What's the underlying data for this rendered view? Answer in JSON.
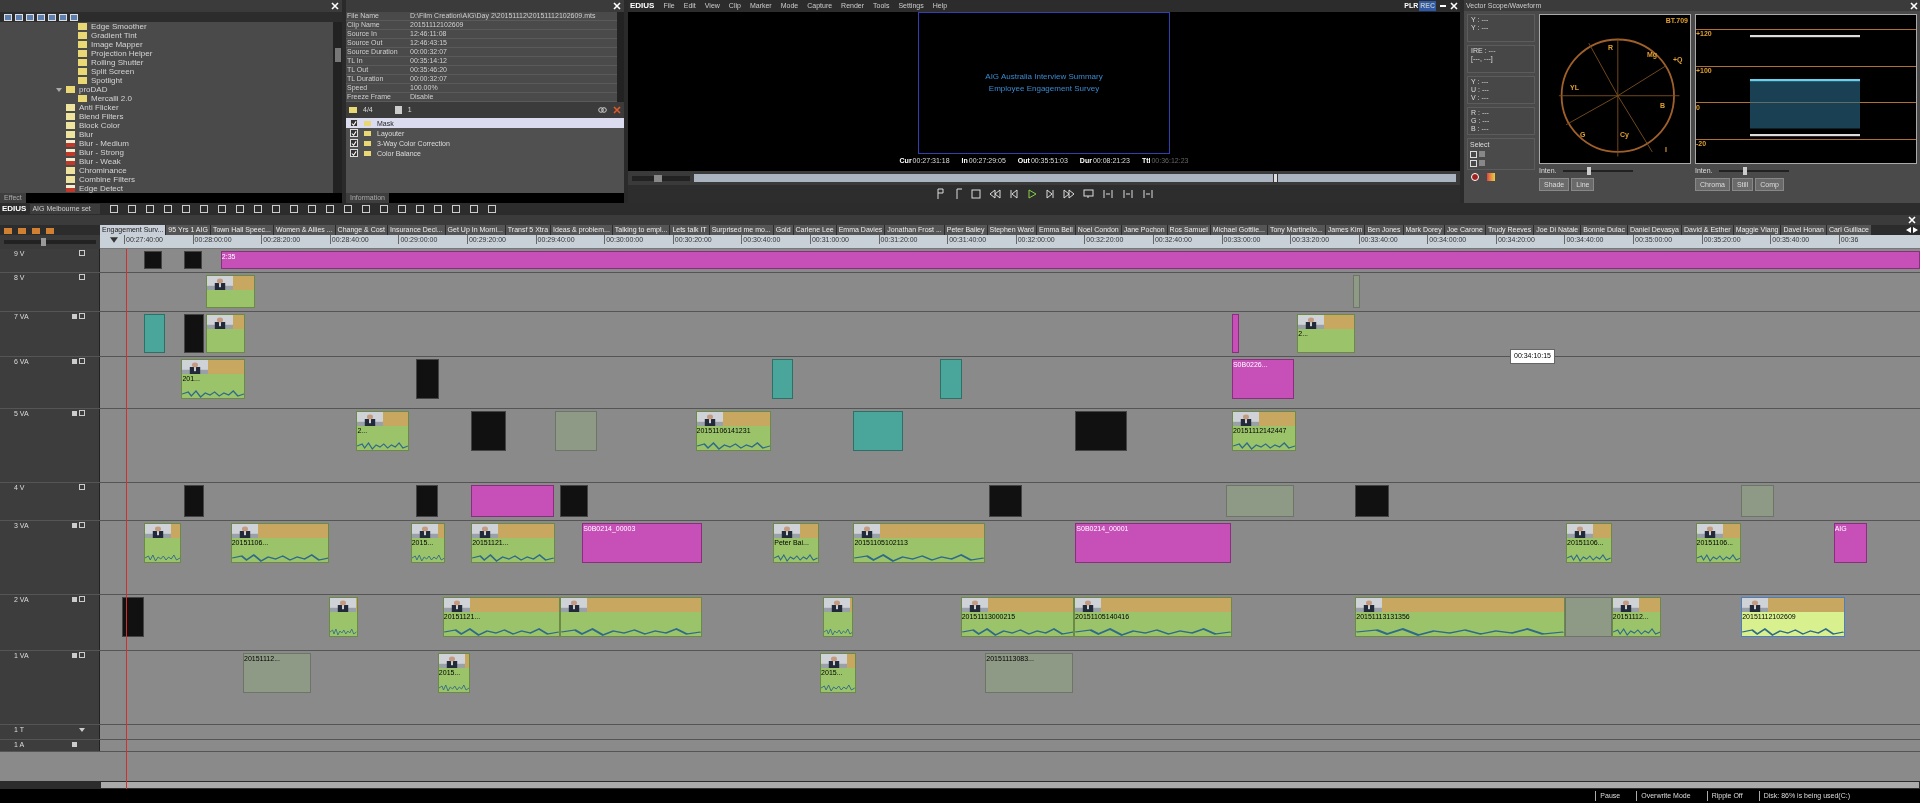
{
  "effect_panel": {
    "tab": "Effect",
    "tree": [
      {
        "kind": "effect",
        "label": "Edge Smoother"
      },
      {
        "kind": "effect",
        "label": "Gradient Tint"
      },
      {
        "kind": "effect",
        "label": "Image Mapper"
      },
      {
        "kind": "effect",
        "label": "Projection Helper"
      },
      {
        "kind": "effect",
        "label": "Rolling Shutter"
      },
      {
        "kind": "effect",
        "label": "Split Screen"
      },
      {
        "kind": "effect",
        "label": "Spotlight"
      },
      {
        "kind": "folder",
        "label": "proDAD",
        "expanded": true,
        "children": [
          {
            "kind": "effect",
            "label": "Mercalli 2.0"
          }
        ]
      },
      {
        "kind": "filter",
        "label": "Anti Flicker"
      },
      {
        "kind": "filter",
        "label": "Blend Filters"
      },
      {
        "kind": "filter",
        "label": "Block Color"
      },
      {
        "kind": "filter",
        "label": "Blur"
      },
      {
        "kind": "red",
        "label": "Blur - Medium"
      },
      {
        "kind": "red",
        "label": "Blur - Strong"
      },
      {
        "kind": "red",
        "label": "Blur - Weak"
      },
      {
        "kind": "filter",
        "label": "Chrominance"
      },
      {
        "kind": "filter",
        "label": "Combine Filters"
      },
      {
        "kind": "red",
        "label": "Edge Detect"
      }
    ]
  },
  "info_panel": {
    "tab": "Information",
    "rows": [
      {
        "label": "File Name",
        "value": "D:\\Film Creation\\AIG\\Day 2\\20151112\\20151112102609.mts"
      },
      {
        "label": "Clip Name",
        "value": "20151112102609"
      },
      {
        "label": "Source In",
        "value": "12:46:11:08"
      },
      {
        "label": "Source Out",
        "value": "12:46:43:15"
      },
      {
        "label": "Source Duration",
        "value": "00:00:32:07"
      },
      {
        "label": "TL In",
        "value": "00:35:14:12"
      },
      {
        "label": "TL Out",
        "value": "00:35:46:20"
      },
      {
        "label": "TL Duration",
        "value": "00:00:32:07"
      },
      {
        "label": "Speed",
        "value": "100.00%"
      },
      {
        "label": "Freeze Frame",
        "value": "Disable"
      }
    ],
    "filter_count": "4/4",
    "layer_count": "1",
    "filters": [
      {
        "label": "Mask",
        "checked": true,
        "selected": true
      },
      {
        "label": "Layouter",
        "checked": true,
        "selected": false
      },
      {
        "label": "3-Way Color Correction",
        "checked": true,
        "selected": false
      },
      {
        "label": "Color Balance",
        "checked": true,
        "selected": false
      }
    ]
  },
  "player": {
    "app": "EDIUS",
    "menu": [
      "File",
      "Edit",
      "View",
      "Clip",
      "Marker",
      "Mode",
      "Capture",
      "Render",
      "Tools",
      "Settings",
      "Help"
    ],
    "modes": [
      {
        "label": "PLR",
        "selected": false
      },
      {
        "label": "REC",
        "selected": true
      }
    ],
    "screen_lines": [
      "AIG Australia Interview Summary",
      "Employee Engagement Survey"
    ],
    "timecodes": [
      {
        "label": "Cur",
        "value": "00:27:31:18",
        "dim": false
      },
      {
        "label": "In",
        "value": "00:27:29:05",
        "dim": false
      },
      {
        "label": "Out",
        "value": "00:35:51:03",
        "dim": false
      },
      {
        "label": "Dur",
        "value": "00:08:21:23",
        "dim": false
      },
      {
        "label": "Ttl",
        "value": "00:36:12:23",
        "dim": true
      }
    ],
    "position": {
      "level": 0.76
    },
    "shuttle": {
      "level": 0.45
    }
  },
  "scopes": {
    "title": "Vector Scope/Waveform",
    "readouts": [
      [
        "Y : ---",
        "Y : ---"
      ],
      [
        "IRE : ---",
        "[---, ---]"
      ],
      [
        "Y : ---",
        "U : ---",
        "V : ---"
      ],
      [
        "R : ---",
        "G : ---",
        "B : ---"
      ]
    ],
    "select_label": "Select",
    "select_options": [
      {
        "checked": false
      },
      {
        "checked": false
      }
    ],
    "standard": "BT.709",
    "vector_labels": [
      "R",
      "Mg",
      "+Q",
      "YL",
      "B",
      "G",
      "Cy",
      "I"
    ],
    "waveform_labels": [
      "+120",
      "+100",
      "0",
      "-20"
    ],
    "vector_intensity": {
      "label": "Inten.",
      "level": 0.35
    },
    "waveform_intensity": {
      "label": "Inten.",
      "level": 0.35
    },
    "vector_buttons": [
      "Shade",
      "Line"
    ],
    "waveform_buttons": [
      "Chroma",
      "Still",
      "Comp"
    ]
  },
  "timeline": {
    "app": "EDIUS",
    "project": "AIG Melbourne set",
    "zoom": {
      "level": 0.4
    },
    "sequences": [
      {
        "label": "Engagement Surv...",
        "selected": true
      },
      {
        "label": "95 Yrs 1 AIG",
        "selected": false
      },
      {
        "label": "Town Hall Speec...",
        "selected": false
      },
      {
        "label": "Women & Allies ...",
        "selected": false
      },
      {
        "label": "Change & Cost",
        "selected": false
      },
      {
        "label": "Insurance Deci...",
        "selected": false
      },
      {
        "label": "Get Up In Morni...",
        "selected": false
      },
      {
        "label": "Transf 5 Xtra",
        "selected": false
      },
      {
        "label": "Ideas & problem...",
        "selected": false
      },
      {
        "label": "Talking to empl...",
        "selected": false
      },
      {
        "label": "Lets talk IT",
        "selected": false
      },
      {
        "label": "Surprised me mo...",
        "selected": false
      },
      {
        "label": "Gold",
        "selected": false
      },
      {
        "label": "Carlene Lee",
        "selected": false
      },
      {
        "label": "Emma Davies",
        "selected": false
      },
      {
        "label": "Jonathan Frost ...",
        "selected": false
      },
      {
        "label": "Peter Bailey",
        "selected": false
      },
      {
        "label": "Stephen Ward",
        "selected": false
      },
      {
        "label": "Emma Bell",
        "selected": false
      },
      {
        "label": "Noel Condon",
        "selected": false
      },
      {
        "label": "Jane Pochon",
        "selected": false
      },
      {
        "label": "Ros Samuel",
        "selected": false
      },
      {
        "label": "Michael Gottlie...",
        "selected": false
      },
      {
        "label": "Tony Martinello...",
        "selected": false
      },
      {
        "label": "James Kim",
        "selected": false
      },
      {
        "label": "Ben Jones",
        "selected": false
      },
      {
        "label": "Mark Dorey",
        "selected": false
      },
      {
        "label": "Joe Carone",
        "selected": false
      },
      {
        "label": "Trudy Reeves",
        "selected": false
      },
      {
        "label": "Joe Di Natale",
        "selected": false
      },
      {
        "label": "Bonnie Dulac",
        "selected": false
      },
      {
        "label": "Daniel Devasya",
        "selected": false
      },
      {
        "label": "David & Esther",
        "selected": false
      },
      {
        "label": "Maggie Vlang",
        "selected": false
      },
      {
        "label": "Davel Honan",
        "selected": false
      },
      {
        "label": "Carl Gulliace",
        "selected": false
      }
    ],
    "ruler": [
      "00:27:40:00",
      "00:28:00:00",
      "00:28:20:00",
      "00:28:40:00",
      "00:29:00:00",
      "00:29:20:00",
      "00:29:40:00",
      "00:30:00:00",
      "00:30:20:00",
      "00:30:40:00",
      "00:31:00:00",
      "00:31:20:00",
      "00:31:40:00",
      "00:32:00:00",
      "00:32:20:00",
      "00:32:40:00",
      "00:33:00:00",
      "00:33:20:00",
      "00:33:40:00",
      "00:34:00:00",
      "00:34:20:00",
      "00:34:40:00",
      "00:35:00:00",
      "00:35:20:00",
      "00:35:40:00",
      "00:36"
    ],
    "tooltip": "00:34:10:15",
    "tracks": [
      {
        "name": "9 V",
        "kind": "v",
        "clips": [
          {
            "kind": "matte"
          },
          {
            "kind": "matte"
          },
          {
            "kind": "title",
            "label": "2:35"
          }
        ]
      },
      {
        "name": "8 V",
        "kind": "v",
        "clips": [
          {
            "kind": "video"
          },
          {
            "kind": "muted"
          }
        ]
      },
      {
        "name": "7 VA",
        "kind": "va",
        "clips": [
          {
            "kind": "teal"
          },
          {
            "kind": "matte"
          },
          {
            "kind": "video"
          },
          {
            "kind": "title"
          },
          {
            "kind": "video",
            "label": "2..."
          }
        ]
      },
      {
        "name": "6 VA",
        "kind": "va",
        "clips": [
          {
            "kind": "video",
            "label": "201..."
          },
          {
            "kind": "matte"
          },
          {
            "kind": "teal"
          },
          {
            "kind": "teal"
          },
          {
            "kind": "title",
            "label": "S0B0226..."
          }
        ]
      },
      {
        "name": "5 VA",
        "kind": "va",
        "clips": [
          {
            "kind": "video",
            "label": "2..."
          },
          {
            "kind": "matte"
          },
          {
            "kind": "muted"
          },
          {
            "kind": "video",
            "label": "20151106141231"
          },
          {
            "kind": "teal"
          },
          {
            "kind": "matte"
          },
          {
            "kind": "video",
            "label": "20151112142447"
          }
        ]
      },
      {
        "name": "4 V",
        "kind": "v",
        "clips": [
          {
            "kind": "matte"
          },
          {
            "kind": "matte"
          },
          {
            "kind": "title"
          },
          {
            "kind": "matte"
          },
          {
            "kind": "matte"
          },
          {
            "kind": "muted"
          },
          {
            "kind": "matte"
          },
          {
            "kind": "muted"
          }
        ]
      },
      {
        "name": "3 VA",
        "kind": "va",
        "clips": [
          {
            "kind": "video"
          },
          {
            "kind": "video",
            "label": "20151106..."
          },
          {
            "kind": "video",
            "label": "2015..."
          },
          {
            "kind": "video",
            "label": "20151121..."
          },
          {
            "kind": "title",
            "label": "S0B0214_00003"
          },
          {
            "kind": "video",
            "label": "Peter Bai..."
          },
          {
            "kind": "video",
            "label": "20151105102113"
          },
          {
            "kind": "title",
            "label": "S0B0214_00001"
          },
          {
            "kind": "video",
            "label": "20151106..."
          },
          {
            "kind": "video",
            "label": "20151106..."
          },
          {
            "kind": "title",
            "label": "AIG"
          }
        ]
      },
      {
        "name": "2 VA",
        "kind": "va",
        "clips": [
          {
            "kind": "matte"
          },
          {
            "kind": "video"
          },
          {
            "kind": "video",
            "label": "20151121..."
          },
          {
            "kind": "video"
          },
          {
            "kind": "video"
          },
          {
            "kind": "video",
            "label": "20151113000215"
          },
          {
            "kind": "video",
            "label": "20151105140416"
          },
          {
            "kind": "video",
            "label": "20151113131356"
          },
          {
            "kind": "muted"
          },
          {
            "kind": "video",
            "label": "20151112..."
          },
          {
            "kind": "picked",
            "label": "20151112102609"
          }
        ]
      },
      {
        "name": "1 VA",
        "kind": "va",
        "clips": [
          {
            "kind": "muted",
            "label": "20151112..."
          },
          {
            "kind": "video",
            "label": "2015..."
          },
          {
            "kind": "video",
            "label": "2015..."
          },
          {
            "kind": "muted",
            "label": "20151113083..."
          }
        ]
      },
      {
        "name": "1 T",
        "kind": "t"
      },
      {
        "name": "1 A",
        "kind": "a"
      }
    ]
  },
  "status_bar": [
    "Pause",
    "Overwrite Mode",
    "Ripple Off",
    "Disk: 86% is being used(C:)"
  ]
}
